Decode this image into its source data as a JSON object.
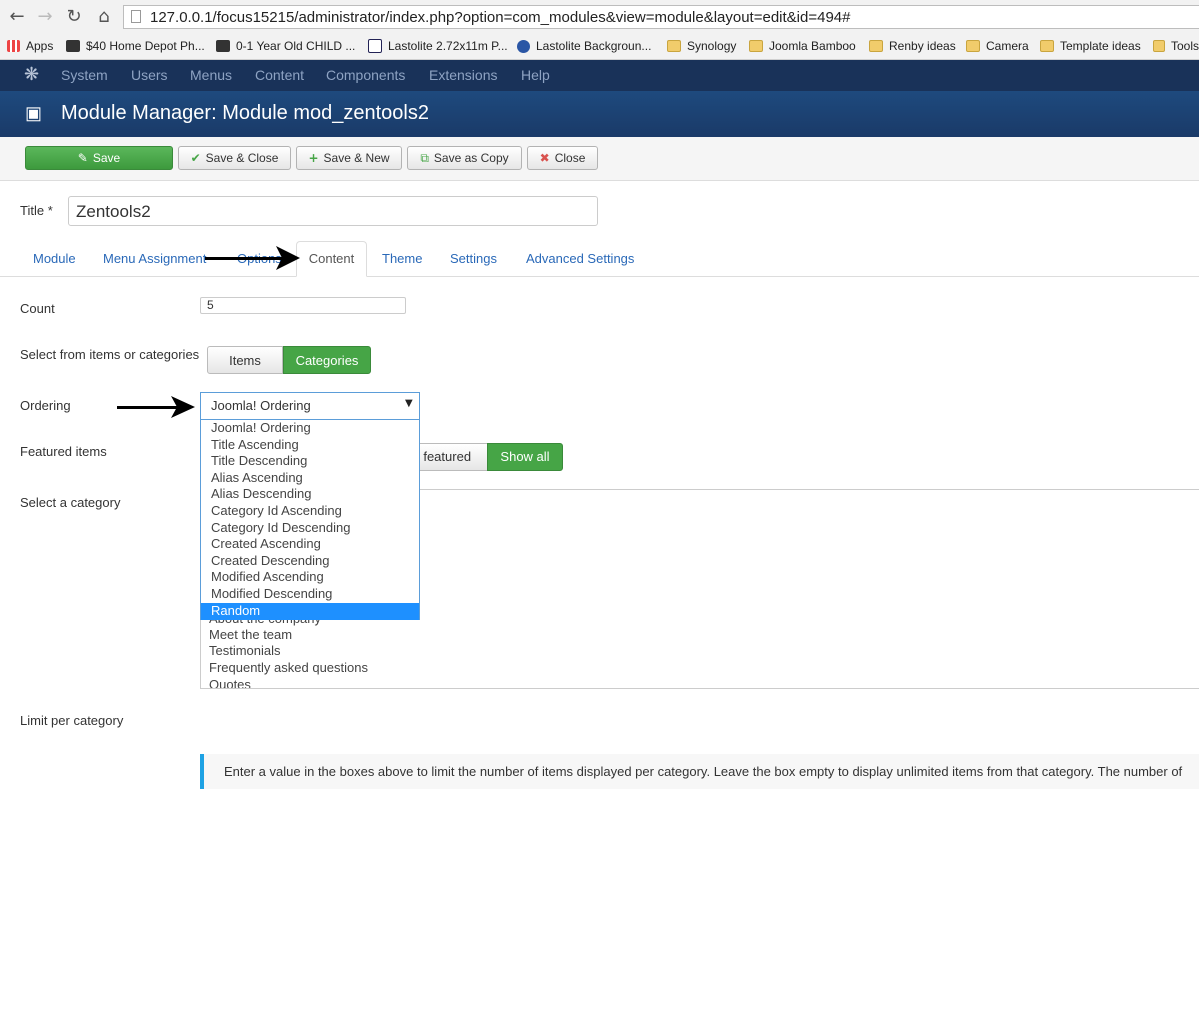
{
  "browser": {
    "url": "127.0.0.1/focus15215/administrator/index.php?option=com_modules&view=module&layout=edit&id=494#",
    "bookmarks": [
      "Apps",
      "$40 Home Depot Ph...",
      "0-1 Year Old CHILD ...",
      "Lastolite 2.72x11m P...",
      "Lastolite Backgroun...",
      "Synology",
      "Joomla Bamboo",
      "Renby ideas",
      "Camera",
      "Template ideas",
      "Tools"
    ]
  },
  "nav": {
    "items": [
      "System",
      "Users",
      "Menus",
      "Content",
      "Components",
      "Extensions",
      "Help"
    ]
  },
  "header": {
    "title": "Module Manager: Module mod_zentools2"
  },
  "toolbar": {
    "save": "Save",
    "save_close": "Save & Close",
    "save_new": "Save & New",
    "save_copy": "Save as Copy",
    "close": "Close"
  },
  "form": {
    "title_label": "Title *",
    "title_value": "Zentools2",
    "tabs": [
      "Module",
      "Menu Assignment",
      "Options",
      "Content",
      "Theme",
      "Settings",
      "Advanced Settings"
    ],
    "count_label": "Count",
    "count_value": "5",
    "select_from_label": "Select from items or categories",
    "select_from_options": [
      "Items",
      "Categories"
    ],
    "ordering_label": "Ordering",
    "ordering_value": "Joomla! Ordering",
    "ordering_options": [
      "Joomla! Ordering",
      "Title Ascending",
      "Title Descending",
      "Alias Ascending",
      "Alias Descending",
      "Category Id Ascending",
      "Category Id Descending",
      "Created Ascending",
      "Created Descending",
      "Modified Ascending",
      "Modified Descending",
      "Random"
    ],
    "featured_label": "Featured items",
    "featured_options": [
      "Only featured",
      "Show all"
    ],
    "category_label": "Select a category",
    "categories": [
      "About the company",
      "Meet the team",
      "Testimonials",
      "Frequently asked questions",
      "Quotes"
    ],
    "limit_label": "Limit per category",
    "hint": "Enter a value in the boxes above to limit the number of items displayed per category. Leave the box empty to display unlimited items from that category. The number of"
  },
  "colors": {
    "nav_bg": "#193259",
    "header_bg": "#1e4a7e",
    "save_green": "#46a546",
    "link_blue": "#2a69b8",
    "selected_option": "#1e90ff"
  }
}
